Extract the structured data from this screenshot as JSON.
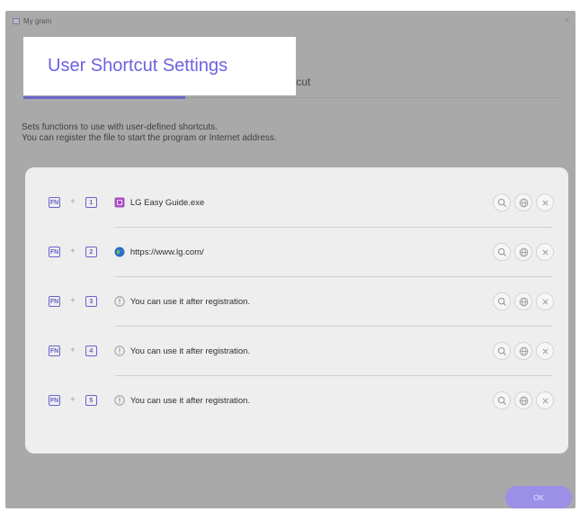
{
  "window": {
    "title": "My gram",
    "close_label": "×"
  },
  "header": {
    "title": "User Shortcut Settings",
    "tab2_fragment": "tcut"
  },
  "description": {
    "line1": "Sets functions to use with user-defined shortcuts.",
    "line2": "You can register the file to start the program or Internet address."
  },
  "shortcut_prefix": "FN",
  "plus_sign": "+",
  "rows": [
    {
      "number": "1",
      "icon": "program-icon",
      "text": "LG Easy Guide.exe"
    },
    {
      "number": "2",
      "icon": "globe-icon",
      "text": "https://www.lg.com/"
    },
    {
      "number": "3",
      "icon": "info-icon",
      "text": "You can use it after registration."
    },
    {
      "number": "4",
      "icon": "info-icon",
      "text": "You can use it after registration."
    },
    {
      "number": "5",
      "icon": "info-icon",
      "text": "You can use it after registration."
    }
  ],
  "actions": [
    "search-icon",
    "globe-icon",
    "close-icon"
  ],
  "ok_label": "OK",
  "colors": {
    "accent": "#6e61e0",
    "overlay": "#a9a9a9",
    "ok_button": "#9b8fe8"
  }
}
